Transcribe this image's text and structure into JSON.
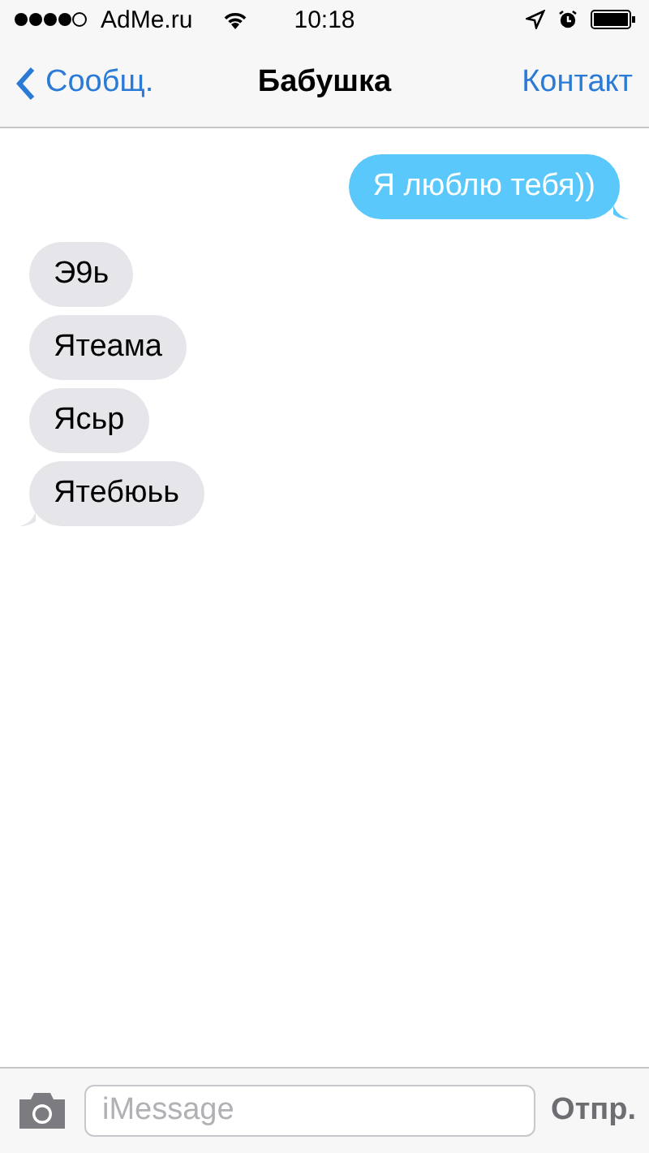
{
  "status_bar": {
    "carrier": "AdMe.ru",
    "time": "10:18"
  },
  "nav_bar": {
    "back": "Сообщ.",
    "title": "Бабушка",
    "action": "Контакт"
  },
  "messages": [
    {
      "text": "Я люблю тебя))",
      "kind": "sent",
      "tail": true
    },
    {
      "text": "Э9ь",
      "kind": "received",
      "tail": false
    },
    {
      "text": "Ятеама",
      "kind": "received",
      "tail": false
    },
    {
      "text": "Ясьр",
      "kind": "received",
      "tail": false
    },
    {
      "text": "Ятебюьь",
      "kind": "received",
      "tail": true
    }
  ],
  "input_bar": {
    "placeholder": "iMessage",
    "send": "Отпр.",
    "send_disabled": true
  }
}
